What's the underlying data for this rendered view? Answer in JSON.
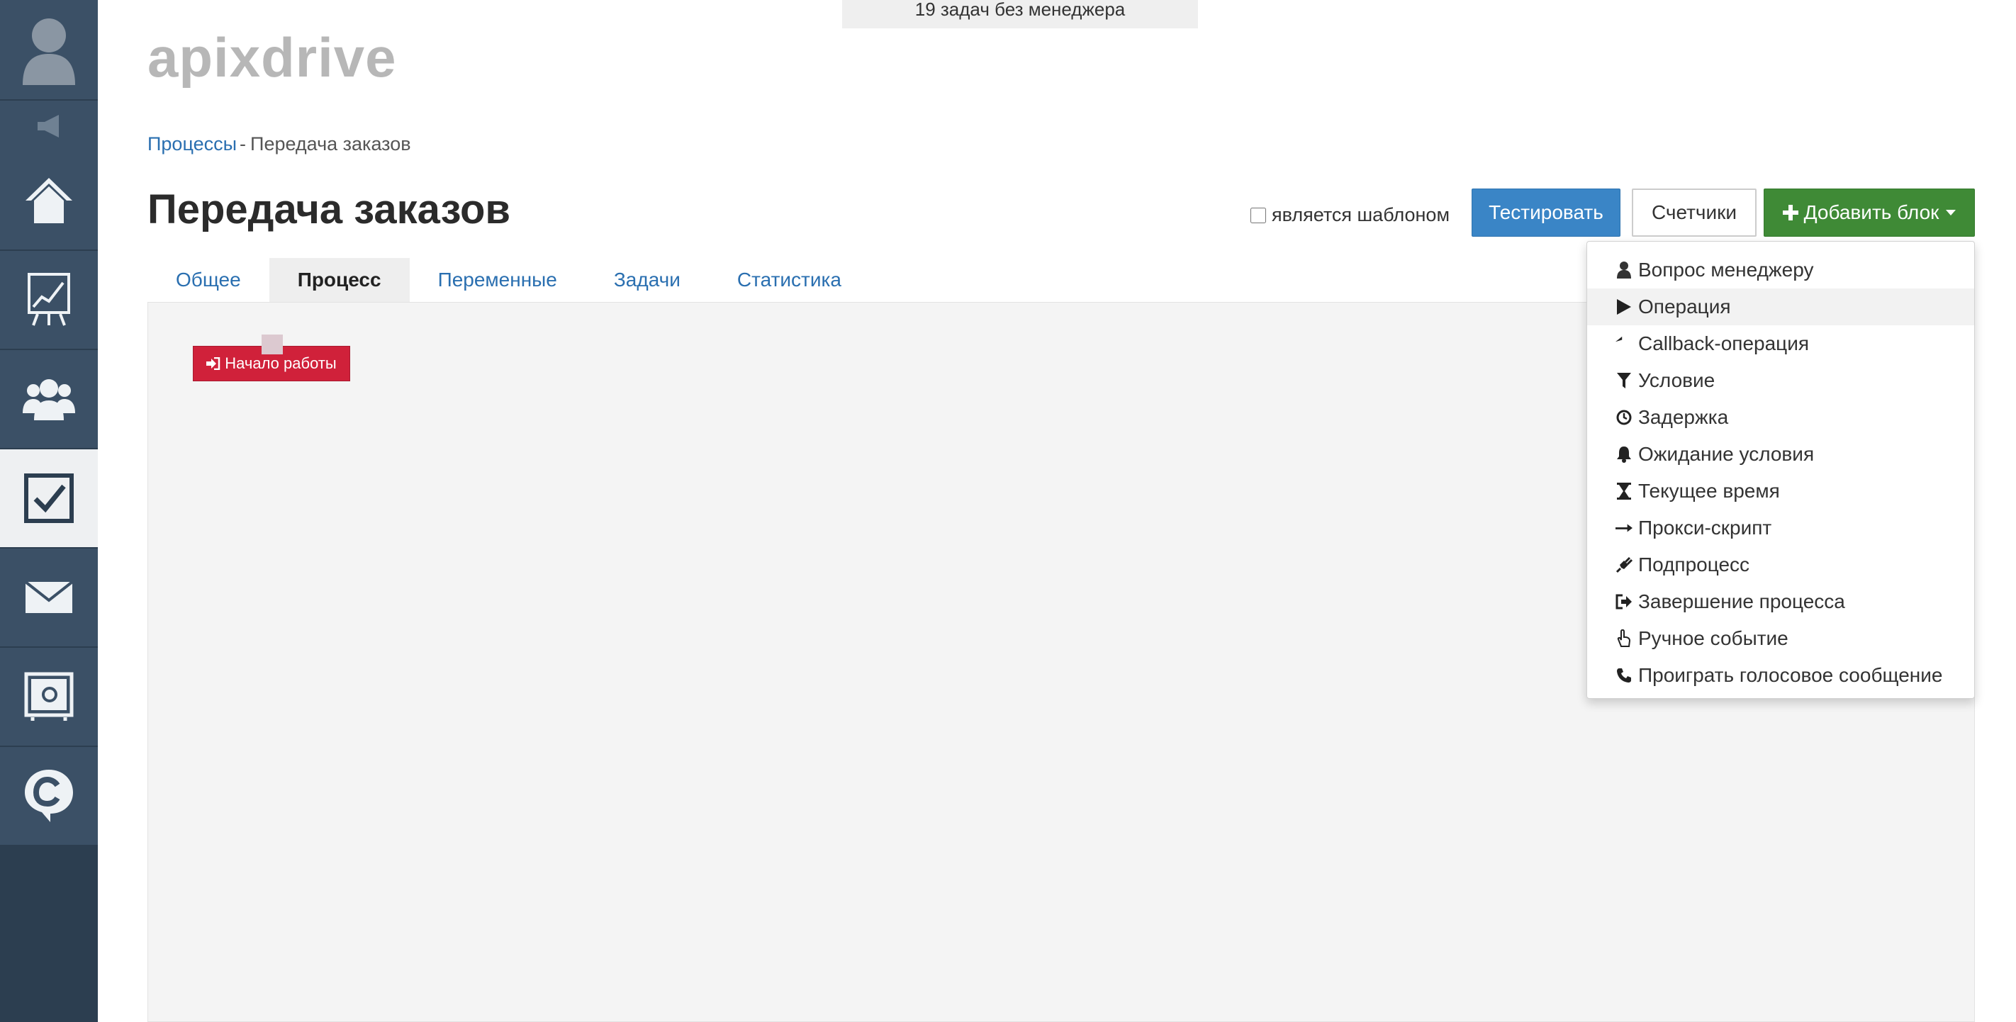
{
  "notice": {
    "text": "19 задач без менеджера"
  },
  "brand": {
    "text": "apixdrive"
  },
  "breadcrumb": {
    "parent": "Процессы",
    "separator": "-",
    "current": "Передача заказов"
  },
  "page": {
    "title": "Передача заказов"
  },
  "toolbar": {
    "template_label": "является шаблоном",
    "template_checked": false,
    "test_label": "Тестировать",
    "counters_label": "Счетчики",
    "add_block_label": "Добавить блок"
  },
  "tabs": [
    {
      "label": "Общее",
      "active": false
    },
    {
      "label": "Процесс",
      "active": true
    },
    {
      "label": "Переменные",
      "active": false
    },
    {
      "label": "Задачи",
      "active": false
    },
    {
      "label": "Статистика",
      "active": false
    }
  ],
  "canvas": {
    "start_block_label": "Начало работы"
  },
  "dropdown": {
    "items": [
      {
        "label": "Вопрос менеджеру",
        "icon": "user-icon"
      },
      {
        "label": "Операция",
        "icon": "play-icon"
      },
      {
        "label": "Callback-операция",
        "icon": "reply-icon"
      },
      {
        "label": "Условие",
        "icon": "filter-icon"
      },
      {
        "label": "Задержка",
        "icon": "clock-icon"
      },
      {
        "label": "Ожидание условия",
        "icon": "bell-icon"
      },
      {
        "label": "Текущее время",
        "icon": "hourglass-icon"
      },
      {
        "label": "Прокси-скрипт",
        "icon": "arrow-right-icon"
      },
      {
        "label": "Подпроцесс",
        "icon": "plug-icon"
      },
      {
        "label": "Завершение процесса",
        "icon": "sign-out-icon"
      },
      {
        "label": "Ручное событие",
        "icon": "hand-pointer-icon"
      },
      {
        "label": "Проиграть голосовое сообщение",
        "icon": "phone-icon"
      }
    ],
    "hovered_item": "Операция"
  },
  "sidebar": {
    "items": [
      {
        "icon": "home-icon",
        "active": false
      },
      {
        "icon": "chart-board-icon",
        "active": false
      },
      {
        "icon": "users-icon",
        "active": false
      },
      {
        "icon": "tasks-checkbox-icon",
        "active": true
      },
      {
        "icon": "mail-icon",
        "active": false
      },
      {
        "icon": "safe-icon",
        "active": false
      },
      {
        "icon": "chat-c-icon",
        "active": false
      }
    ]
  },
  "colors": {
    "sidebar_bg": "#2c3e50",
    "sidebar_item_bg": "#3b5066",
    "primary_blue": "#3a85c6",
    "success_green": "#3f8a36",
    "start_block_red": "#d0213a",
    "link_blue": "#2a6fb0"
  }
}
